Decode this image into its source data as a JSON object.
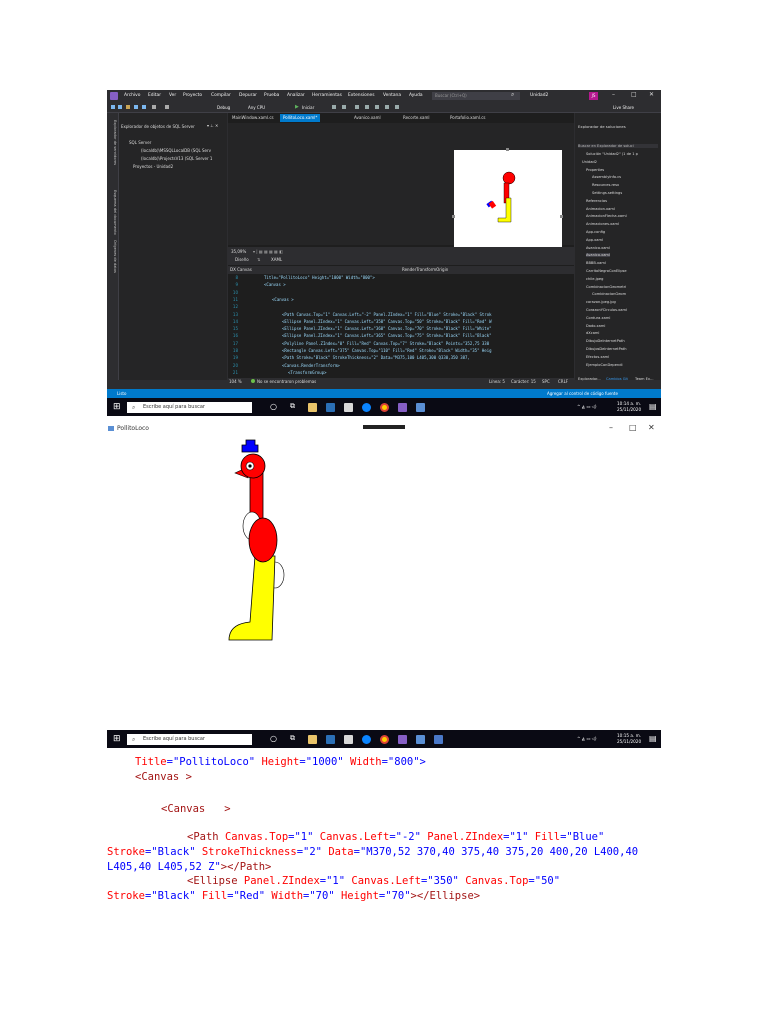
{
  "vs": {
    "menu": [
      "Archivo",
      "Editar",
      "Ver",
      "Proyecto",
      "Compilar",
      "Depurar",
      "Prueba",
      "Analizar",
      "Herramientas",
      "Extensiones",
      "Ventana",
      "Ayuda"
    ],
    "search_placeholder": "Buscar (Ctrl+Q)",
    "solution_name": "Unidad2",
    "user_initials": "JS",
    "live_share": "Live Share",
    "toolbar": {
      "config": "Debug",
      "platform": "Any CPU",
      "start": "Iniciar"
    },
    "side_tabs": [
      "Explorador de servidores",
      "Esquema del documento",
      "Orígenes de datos"
    ],
    "left_panel": {
      "title": "Explorador de objetos de SQL Server",
      "items": [
        "SQL Server",
        "(localdb)\\MSSQLLocalDB (SQL Serv",
        "(localdb)\\ProjectsV13 (SQL Server 1",
        "Proyectos - Unidad2"
      ]
    },
    "doc_tabs": [
      "MainWindow.xaml.cs",
      "PollitoLoco.xaml*",
      "Avanico.xaml",
      "Recorte.xaml",
      "Portafolio.xaml.cs"
    ],
    "zoom": "35,09%",
    "view_tabs": [
      "Diseño",
      "XAML"
    ],
    "breadcrumb_left": "DX Canvas",
    "breadcrumb_right": "RenderTransformOrigin",
    "code_lines": [
      {
        "n": "8",
        "t": "Title=\"PollitoLoco\" Height=\"1000\" Width=\"800\">"
      },
      {
        "n": "9",
        "t": "<Canvas >"
      },
      {
        "n": "10",
        "t": ""
      },
      {
        "n": "11",
        "t": "<Canvas   >"
      },
      {
        "n": "12",
        "t": ""
      },
      {
        "n": "13",
        "t": "<Path Canvas.Top=\"1\" Canvas.Left=\"-2\" Panel.ZIndex=\"1\" Fill=\"Blue\" Stroke=\"Black\" Strok"
      },
      {
        "n": "14",
        "t": "<Ellipse Panel.ZIndex=\"1\" Canvas.Left=\"350\" Canvas.Top=\"50\" Stroke=\"Black\" Fill=\"Red\" W"
      },
      {
        "n": "15",
        "t": "<Ellipse Panel.ZIndex=\"1\" Canvas.Left=\"360\" Canvas.Top=\"70\" Stroke=\"Black\" Fill=\"White\""
      },
      {
        "n": "16",
        "t": "<Ellipse Panel.ZIndex=\"1\" Canvas.Left=\"365\" Canvas.Top=\"75\" Stroke=\"Black\" Fill=\"Black\""
      },
      {
        "n": "17",
        "t": "<Polyline Panel.ZIndex=\"0\" Fill=\"Red\" Canvas.Top=\"7\"  Stroke=\"Black\" Points=\"352,75 330"
      },
      {
        "n": "18",
        "t": "<Rectangle Canvas.Left=\"375\" Canvas.Top=\"110\" Fill=\"Red\" Stroke=\"Black\" Width=\"35\" Heig"
      },
      {
        "n": "19",
        "t": "<Path Stroke=\"Black\" StrokeThickness=\"2\" Data=\"M375,100 L405,300 Q330,350 387,"
      },
      {
        "n": "20",
        "t": "<Canvas.RenderTransform>"
      },
      {
        "n": "21",
        "t": "<TransformGroup>"
      }
    ],
    "status": {
      "zoom": "104 %",
      "problems": "No se encontraron problemas",
      "line": "Línea: 5",
      "col": "Carácter: 15",
      "enc": "SPC",
      "eol": "CRLF"
    },
    "right_panel": {
      "title": "Explorador de soluciones",
      "search": "Buscar en Explorador de soluci",
      "items": [
        "Solución \"Unidad2\" (1 de 1 p",
        "Unidad2",
        "Properties",
        "AssemblyInfo.cs",
        "Resources.resx",
        "Settings.settings",
        "Referencias",
        "Animacion.xaml",
        "AnimacionFlecha.xaml",
        "Animaciones.xaml",
        "App.config",
        "App.xaml",
        "Avanico.xaml",
        "Avanico.xaml",
        "BBBB.xaml",
        "CarritoNegroConElipse",
        "chile.jpeg",
        "CombinacionGeometri",
        "CombinacionGeom",
        "corazon.jpeg.jpg",
        "CorazonYCirculos.xaml",
        "Cordura.xaml",
        "Dado.xaml",
        "dXcaml",
        "DibujoDelnternetPath",
        "DibujosDelnternetPath",
        "Efectos.xaml",
        "EjemploConDependi"
      ],
      "tabs": [
        "Explorador...",
        "Cambios Git",
        "Team Ex..."
      ]
    },
    "listo": "Listo",
    "source_control": "Agregar al control de código fuente",
    "taskbar": {
      "search": "Escribe aquí para buscar",
      "time": "10:14 a. m.",
      "date": "25/11/2020"
    }
  },
  "app": {
    "title": "PollitoLoco",
    "taskbar": {
      "search": "Escribe aquí para buscar",
      "time": "10:15 a. m.",
      "date": "25/11/2020"
    }
  },
  "code_text": {
    "line1": {
      "a1": "Title",
      "v1": "\"PollitoLoco\"",
      "a2": "Height",
      "v2": "\"1000\"",
      "a3": "Width",
      "v3": "\"800\"",
      "end": ">"
    },
    "line2": "<Canvas >",
    "line3": "<Canvas   >",
    "line4": {
      "tag": "<Path",
      "a1": "Canvas.Top",
      "v1": "\"1\"",
      "a2": "Canvas.Left",
      "v2": "\"-2\"",
      "a3": "Panel.ZIndex",
      "v3": "\"1\"",
      "a4": "Fill",
      "v4": "\"Blue\""
    },
    "line5": {
      "a1": "Stroke",
      "v1": "\"Black\"",
      "a2": "StrokeThickness",
      "v2": "\"2\"",
      "a3": "Data",
      "v3": "\"M370,52 370,40 375,40 375,20 400,20 L400,40"
    },
    "line6": {
      "v": "L405,40 L405,52 Z\"",
      "end": "></Path>"
    },
    "line7": {
      "tag": "<Ellipse",
      "a1": "Panel.ZIndex",
      "v1": "\"1\"",
      "a2": "Canvas.Left",
      "v2": "\"350\"",
      "a3": "Canvas.Top",
      "v3": "\"50\""
    },
    "line8": {
      "a1": "Stroke",
      "v1": "\"Black\"",
      "a2": "Fill",
      "v2": "\"Red\"",
      "a3": "Width",
      "v3": "\"70\"",
      "a4": "Height",
      "v4": "\"70\"",
      "end": "></Ellipse>"
    }
  }
}
